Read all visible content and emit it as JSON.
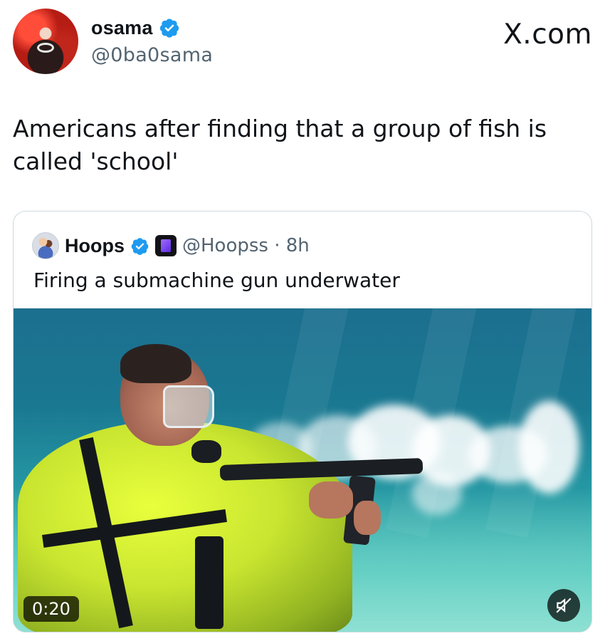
{
  "author": {
    "display_name": "osama",
    "handle": "@0ba0sama",
    "verified": true,
    "avatar_icon": "profile-avatar"
  },
  "watermark": "X.com",
  "tweet": {
    "text": "Americans after finding that a group of fish is called 'school'"
  },
  "quoted_tweet": {
    "display_name": "Hoops",
    "verified": true,
    "affiliate_icon": "affiliate-badge-icon",
    "handle_time": "@Hoopss · 8h",
    "text": "Firing a submachine gun underwater",
    "media": {
      "type": "video",
      "description_icon": "underwater-video-thumbnail",
      "duration": "0:20",
      "mute_icon": "speaker-muted-icon"
    }
  },
  "colors": {
    "verified_blue": "#1d9bf0",
    "text": "#0f1419",
    "secondary_text": "#536471",
    "border": "#cfd9de"
  }
}
